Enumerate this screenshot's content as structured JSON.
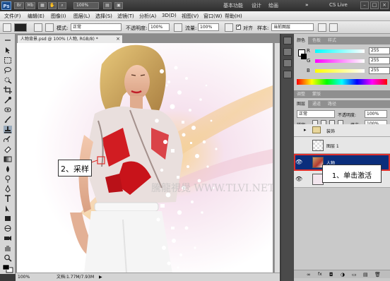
{
  "appbar": {
    "logo": "Ps",
    "zoom": "100%",
    "workspaces": [
      "基本功能",
      "设计",
      "绘画"
    ],
    "more": "»",
    "cslive": "CS Live",
    "win_controls": [
      "–",
      "□",
      "×"
    ]
  },
  "menu": [
    "文件(F)",
    "编辑(E)",
    "图像(I)",
    "图层(L)",
    "选择(S)",
    "滤镜(T)",
    "分析(A)",
    "3D(D)",
    "视图(V)",
    "窗口(W)",
    "帮助(H)"
  ],
  "options": {
    "mode_label": "模式:",
    "mode_value": "正常",
    "opacity_label": "不透明度:",
    "opacity_value": "100%",
    "flow_label": "流量:",
    "flow_value": "100%",
    "aligned_label": "对齐",
    "aligned_checked": true,
    "sample_label": "样本:",
    "sample_value": "当前图层"
  },
  "document": {
    "tab_title": "人物背景.psd @ 100% (人物, RGB/8) *",
    "close": "×"
  },
  "canvas": {
    "watermark": "騰龍視覺 WWW.TLVI.NET"
  },
  "callouts": {
    "sample": "2、采样",
    "activate": "1、单击激活"
  },
  "status": {
    "zoom": "100%",
    "doc_info": "文档:1.77M/7.93M"
  },
  "color_panel": {
    "tabs": [
      "颜色",
      "色板",
      "样式"
    ],
    "channels": [
      {
        "letter": "R",
        "value": "255"
      },
      {
        "letter": "G",
        "value": "255"
      },
      {
        "letter": "B",
        "value": "255"
      }
    ]
  },
  "adjust_panel": {
    "tabs": [
      "调整",
      "蒙版"
    ]
  },
  "layers_panel": {
    "tabs": [
      "图层",
      "通道",
      "路径"
    ],
    "blend_mode": "正常",
    "opacity_label": "不透明度:",
    "opacity_value": "100%",
    "lock_label": "锁定:",
    "fill_label": "填充:",
    "fill_value": "100%",
    "layers": [
      {
        "name": "装饰"
      },
      {
        "name": "图层 1"
      },
      {
        "name": "人物"
      },
      {
        "name": "背景"
      }
    ],
    "footer_icons": [
      "link-icon",
      "fx-icon",
      "mask-icon",
      "adjustment-icon",
      "folder-icon",
      "new-layer-icon",
      "trash-icon"
    ]
  },
  "colors": {
    "selected_layer": "#0b2e7c",
    "callout_highlight": "#e0302c"
  }
}
